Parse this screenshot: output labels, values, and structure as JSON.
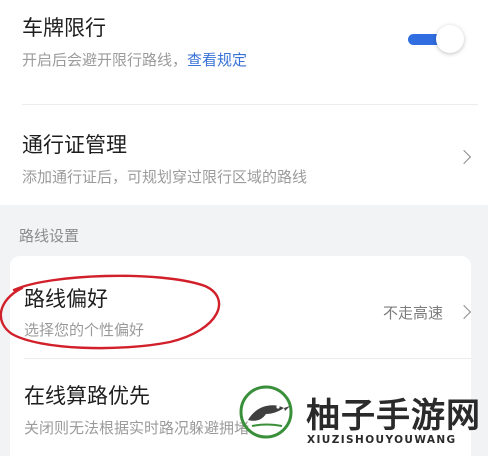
{
  "settings": {
    "plate_restriction": {
      "title": "车牌限行",
      "subtitle": "开启后会避开限行路线，",
      "link": "查看规定",
      "enabled": true
    },
    "permit_management": {
      "title": "通行证管理",
      "subtitle": "添加通行证后，可规划穿过限行区域的路线"
    },
    "route_section_header": "路线设置",
    "route_preference": {
      "title": "路线偏好",
      "subtitle": "选择您的个性偏好",
      "value": "不走高速"
    },
    "online_routing": {
      "title": "在线算路优先",
      "subtitle": "关闭则无法根据实时路况躲避拥堵"
    }
  },
  "watermark": {
    "title": "柚子手游网",
    "subtitle": "XIUZISHOUYOUWANG"
  },
  "colors": {
    "accent": "#2f6de0",
    "link": "#3a73d6",
    "annotation": "#d1202a"
  }
}
